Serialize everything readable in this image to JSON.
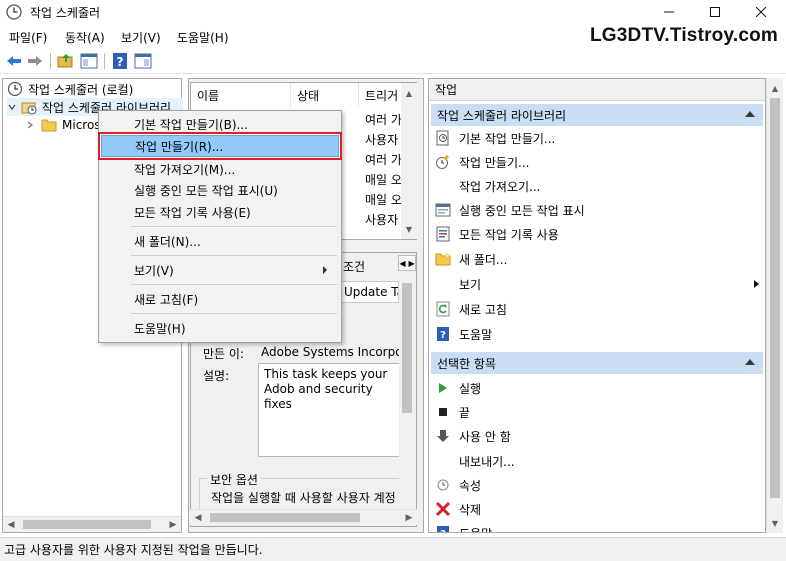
{
  "window": {
    "title": "작업 스케줄러",
    "brand_overlay": "LG3DTV.Tistroy.com"
  },
  "menubar": {
    "items": [
      "파일(F)",
      "동작(A)",
      "보기(V)",
      "도움말(H)"
    ]
  },
  "tree": {
    "root": "작업 스케줄러 (로컬)",
    "library": "작업 스케줄러 라이브러리",
    "child": "Micros"
  },
  "list": {
    "columns": [
      "이름",
      "상태",
      "트리거"
    ],
    "rows": [
      {
        "trigger": "여러 가"
      },
      {
        "trigger": "사용자"
      },
      {
        "trigger": "여러 가"
      },
      {
        "trigger": "매일 오"
      },
      {
        "trigger": "매일 오"
      },
      {
        "trigger": "사용자"
      }
    ]
  },
  "detail": {
    "tab_partial": "조건",
    "name_partial": "Update Tas",
    "author_label": "만든 이:",
    "author_value": "Adobe Systems Incorporat",
    "desc_label": "설명:",
    "desc_value": "This task keeps your Adob and security fixes",
    "security_label": "보안 옵션",
    "security_text": "작업을 실행할 때 사용할 사용자 계정"
  },
  "actions": {
    "header": "작업",
    "section1": "작업 스케줄러 라이브러리",
    "items1": [
      {
        "label": "기본 작업 만들기...",
        "icon": "basic-task-icon"
      },
      {
        "label": "작업 만들기...",
        "icon": "create-task-icon"
      },
      {
        "label": "작업 가져오기...",
        "icon": ""
      },
      {
        "label": "실행 중인 모든 작업 표시",
        "icon": "running-tasks-icon"
      },
      {
        "label": "모든 작업 기록 사용",
        "icon": "history-icon"
      },
      {
        "label": "새 폴더...",
        "icon": "folder-icon"
      },
      {
        "label": "보기",
        "icon": ""
      },
      {
        "label": "새로 고침",
        "icon": "refresh-icon"
      },
      {
        "label": "도움말",
        "icon": "help-icon"
      }
    ],
    "section2": "선택한 항목",
    "items2": [
      {
        "label": "실행",
        "icon": "run-icon"
      },
      {
        "label": "끝",
        "icon": "end-icon"
      },
      {
        "label": "사용 안 함",
        "icon": "disable-icon"
      },
      {
        "label": "내보내기...",
        "icon": ""
      },
      {
        "label": "속성",
        "icon": "properties-icon"
      },
      {
        "label": "삭제",
        "icon": "delete-icon"
      },
      {
        "label": "도움말",
        "icon": "help-icon"
      }
    ]
  },
  "context_menu": {
    "items": [
      "기본 작업 만들기(B)...",
      "작업 만들기(R)...",
      "작업 가져오기(M)...",
      "실행 중인 모든 작업 표시(U)",
      "모든 작업 기록 사용(E)",
      "새 폴더(N)...",
      "보기(V)",
      "새로 고침(F)",
      "도움말(H)"
    ],
    "highlighted": "작업 만들기(R)..."
  },
  "status": {
    "text": "고급 사용자를 위한 사용자 지정된 작업을 만듭니다."
  },
  "colors": {
    "section_bg": "#c9def5",
    "highlight_bg": "#91c9f7",
    "highlight_border": "#e02020"
  }
}
